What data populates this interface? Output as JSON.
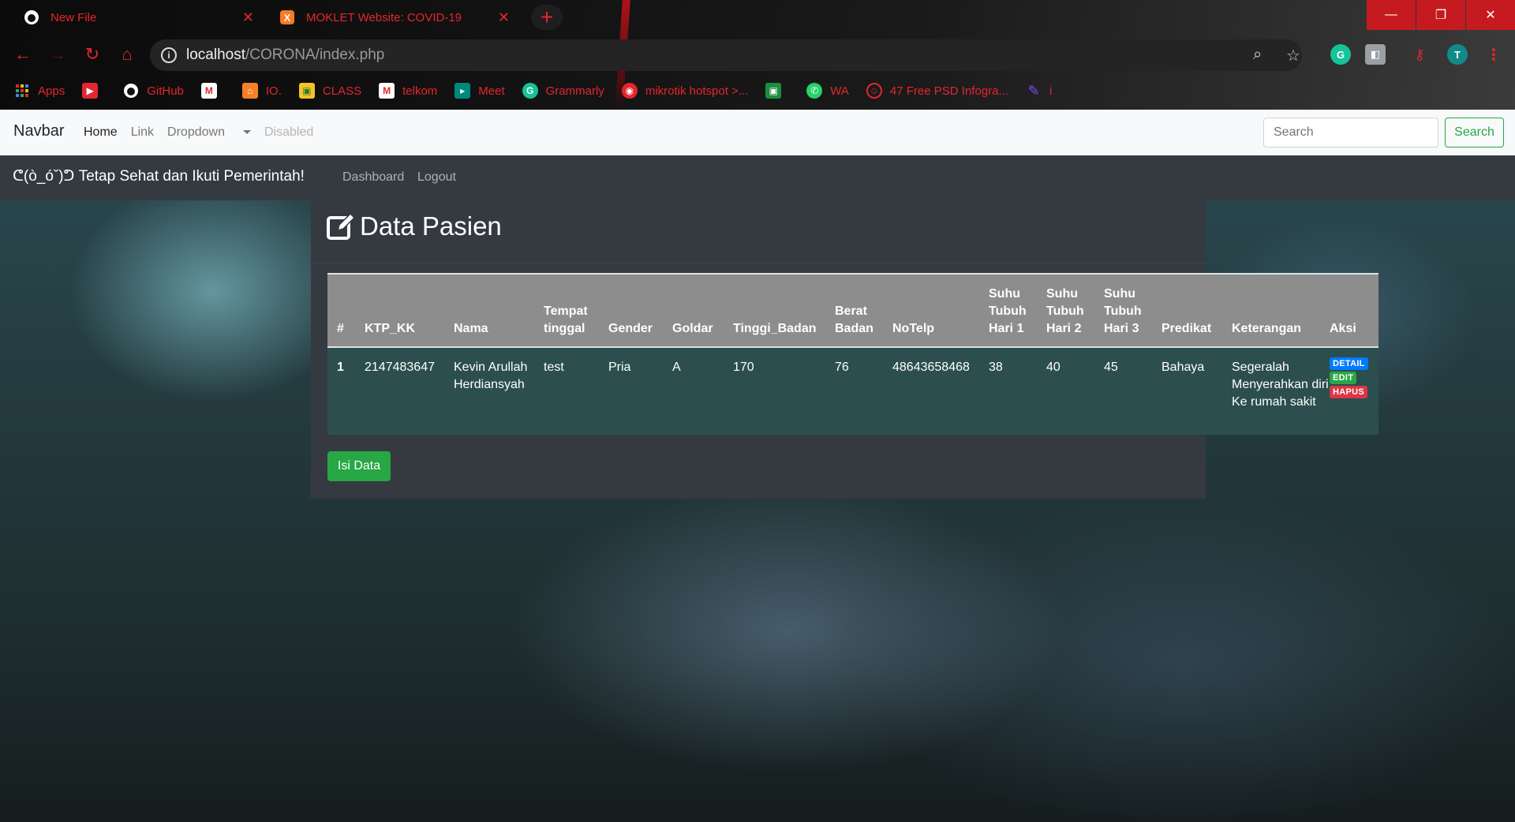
{
  "browser": {
    "tabs": [
      {
        "title": "New File",
        "icon": "github-icon"
      },
      {
        "title": "MOKLET Website: COVID-19",
        "icon": "xampp-icon"
      }
    ],
    "url_host": "localhost",
    "url_path": "/CORONA/index.php",
    "profile_initial": "T",
    "bookmarks": [
      {
        "label": "Apps",
        "icon": "apps-grid-icon"
      },
      {
        "label": "",
        "icon": "youtube-icon"
      },
      {
        "label": "GitHub",
        "icon": "github-icon"
      },
      {
        "label": "",
        "icon": "gmail-icon"
      },
      {
        "label": "IO.",
        "icon": "io-icon"
      },
      {
        "label": "CLASS",
        "icon": "classroom-icon"
      },
      {
        "label": "telkom",
        "icon": "gmail-icon"
      },
      {
        "label": "Meet",
        "icon": "meet-icon"
      },
      {
        "label": "Grammarly",
        "icon": "grammarly-icon"
      },
      {
        "label": "mikrotik hotspot >...",
        "icon": "mikrotik-icon"
      },
      {
        "label": "",
        "icon": "classroom-icon"
      },
      {
        "label": "WA",
        "icon": "whatsapp-icon"
      },
      {
        "label": "47 Free PSD Infogra...",
        "icon": "psd-icon"
      },
      {
        "label": "i",
        "icon": "feather-icon"
      }
    ],
    "accent_color": "#e3262f"
  },
  "navbar": {
    "brand": "Navbar",
    "links": {
      "home": "Home",
      "link": "Link",
      "dropdown": "Dropdown",
      "disabled": "Disabled"
    },
    "search_placeholder": "Search",
    "search_button": "Search"
  },
  "subnav": {
    "title": "ᕦ(ò_óˇ)ᕤ Tetap Sehat dan Ikuti Pemerintah!",
    "links": {
      "dashboard": "Dashboard",
      "logout": "Logout"
    }
  },
  "card": {
    "title": "Data Pasien",
    "table": {
      "headers": [
        "#",
        "KTP_KK",
        "Nama",
        "Tempat tinggal",
        "Gender",
        "Goldar",
        "Tinggi_Badan",
        "Berat Badan",
        "NoTelp",
        "Suhu Tubuh Hari 1",
        "Suhu Tubuh Hari 2",
        "Suhu Tubuh Hari 3",
        "Predikat",
        "Keterangan",
        "Aksi"
      ],
      "rows": [
        {
          "no": "1",
          "ktp_kk": "2147483647",
          "nama": "Kevin Arullah Herdiansyah",
          "tempat_tinggal": "test",
          "gender": "Pria",
          "goldar": "A",
          "tinggi_badan": "170",
          "berat_badan": "76",
          "notelp": "48643658468",
          "suhu_1": "38",
          "suhu_2": "40",
          "suhu_3": "45",
          "predikat": "Bahaya",
          "keterangan": "Segeralah Menyerahkan diri Ke rumah sakit",
          "actions": {
            "detail": "DETAIL",
            "edit": "EDIT",
            "hapus": "HAPUS"
          }
        }
      ]
    },
    "add_button": "Isi Data"
  }
}
